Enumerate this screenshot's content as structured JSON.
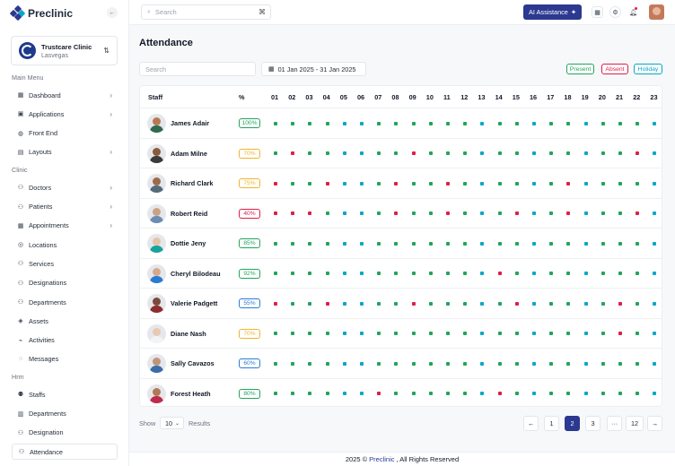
{
  "brand": {
    "name": "Preclinic",
    "collapse_icon": "arrow-left-icon"
  },
  "clinic": {
    "name": "Trustcare Clinic",
    "location": "Lasvegas"
  },
  "sidebar": {
    "sections": [
      {
        "title": "Main Menu",
        "items": [
          {
            "label": "Dashboard",
            "icon": "grid-icon",
            "chevron": true
          },
          {
            "label": "Applications",
            "icon": "apps-icon",
            "chevron": true
          },
          {
            "label": "Front End",
            "icon": "globe-icon",
            "chevron": false
          },
          {
            "label": "Layouts",
            "icon": "layout-icon",
            "chevron": true
          }
        ]
      },
      {
        "title": "Clinic",
        "items": [
          {
            "label": "Doctors",
            "icon": "doctor-icon",
            "chevron": true
          },
          {
            "label": "Patients",
            "icon": "patients-icon",
            "chevron": true
          },
          {
            "label": "Appointments",
            "icon": "calendar-icon",
            "chevron": true
          },
          {
            "label": "Locations",
            "icon": "location-icon",
            "chevron": false
          },
          {
            "label": "Services",
            "icon": "services-icon",
            "chevron": false
          },
          {
            "label": "Designations",
            "icon": "designation-icon",
            "chevron": false
          },
          {
            "label": "Departments",
            "icon": "department-icon",
            "chevron": false
          },
          {
            "label": "Assets",
            "icon": "assets-icon",
            "chevron": false
          },
          {
            "label": "Activities",
            "icon": "activity-icon",
            "chevron": false
          },
          {
            "label": "Messages",
            "icon": "message-icon",
            "chevron": false
          }
        ]
      },
      {
        "title": "Hrm",
        "items": [
          {
            "label": "Staffs",
            "icon": "staffs-icon",
            "chevron": false
          },
          {
            "label": "Departments",
            "icon": "building-icon",
            "chevron": false
          },
          {
            "label": "Designation",
            "icon": "designation-icon",
            "chevron": false
          },
          {
            "label": "Attendance",
            "icon": "attendance-icon",
            "chevron": false,
            "active": true
          }
        ]
      }
    ]
  },
  "topbar": {
    "search_placeholder": "Search",
    "ai_label": "AI Assistance",
    "icons": [
      "calendar-icon",
      "settings-icon",
      "bell-icon"
    ]
  },
  "page": {
    "title": "Attendance",
    "search_placeholder": "Search",
    "date_range": "01 Jan 2025 - 31 Jan 2025",
    "legend": [
      {
        "label": "Present",
        "color": "#22a45d"
      },
      {
        "label": "Absent",
        "color": "#e11d48"
      },
      {
        "label": "Holiday",
        "color": "#06a7c9"
      }
    ]
  },
  "table": {
    "headers": {
      "staff": "Staff",
      "pct": "%"
    },
    "days": [
      "01",
      "02",
      "03",
      "04",
      "05",
      "06",
      "07",
      "08",
      "09",
      "10",
      "11",
      "12",
      "13",
      "14",
      "15",
      "16",
      "17",
      "18",
      "19",
      "20",
      "21",
      "22",
      "23"
    ],
    "rows": [
      {
        "name": "James Adair",
        "pct": "100%",
        "pct_color": "#22a45d",
        "avatar": [
          "#b7794f",
          "#2f6b4f"
        ],
        "status": "PPPPHHPPPPPPHPPHPPHPPPH"
      },
      {
        "name": "Adam Milne",
        "pct": "70%",
        "pct_color": "#f0b429",
        "avatar": [
          "#8a5a3c",
          "#3b3b3b"
        ],
        "status": "PAPPHHPPAPPPHPPHPPHPPAH"
      },
      {
        "name": "Richard Clark",
        "pct": "75%",
        "pct_color": "#f0b429",
        "avatar": [
          "#9c6b4a",
          "#556b7a"
        ],
        "status": "APPAHHPAPPAPHPPHPAHPPPH"
      },
      {
        "name": "Robert Reid",
        "pct": "40%",
        "pct_color": "#e11d48",
        "avatar": [
          "#c9a285",
          "#6b8db3"
        ],
        "status": "AAAPHHPAPPAPHPAHPAHPPAH"
      },
      {
        "name": "Dottie Jeny",
        "pct": "85%",
        "pct_color": "#22a45d",
        "avatar": [
          "#e5c3a8",
          "#1aa29d"
        ],
        "status": "PPPPHHPPPPPPHPPHPPHPPPH"
      },
      {
        "name": "Cheryl Bilodeau",
        "pct": "92%",
        "pct_color": "#22a45d",
        "avatar": [
          "#d7a98c",
          "#2b7bd4"
        ],
        "status": "PPPPHHPPPPPPHAPHPPHPPPH"
      },
      {
        "name": "Valerie Padgett",
        "pct": "55%",
        "pct_color": "#2b7bd4",
        "avatar": [
          "#7a4a3a",
          "#8e2e2e"
        ],
        "status": "APPAHHPPAPPPHPAHPPHPAPH"
      },
      {
        "name": "Diane Nash",
        "pct": "70%",
        "pct_color": "#f0b429",
        "avatar": [
          "#e8c9b2",
          "#f3f4f6"
        ],
        "status": "PPPPHHPPPPPPHPPHPPHPAPH"
      },
      {
        "name": "Sally Cavazos",
        "pct": "60%",
        "pct_color": "#2b7bd4",
        "avatar": [
          "#c09478",
          "#3a6ea8"
        ],
        "status": "PPPPHHPPPPPPHPPHPPHPPPH"
      },
      {
        "name": "Forest Heath",
        "pct": "80%",
        "pct_color": "#22a45d",
        "avatar": [
          "#b07a58",
          "#c02a4a"
        ],
        "status": "PPPPHHAPPPPPHAPHPPHPPPH"
      }
    ]
  },
  "pagination": {
    "show_label": "Show",
    "per_page": "10",
    "results_label": "Results",
    "prev": "←",
    "pages": [
      "1",
      "2",
      "3",
      "···",
      "12"
    ],
    "active_page": "2",
    "next": "→"
  },
  "footer": {
    "prefix": "2025 ©",
    "brand": "Preclinic",
    "suffix": ", All Rights Reserved"
  }
}
